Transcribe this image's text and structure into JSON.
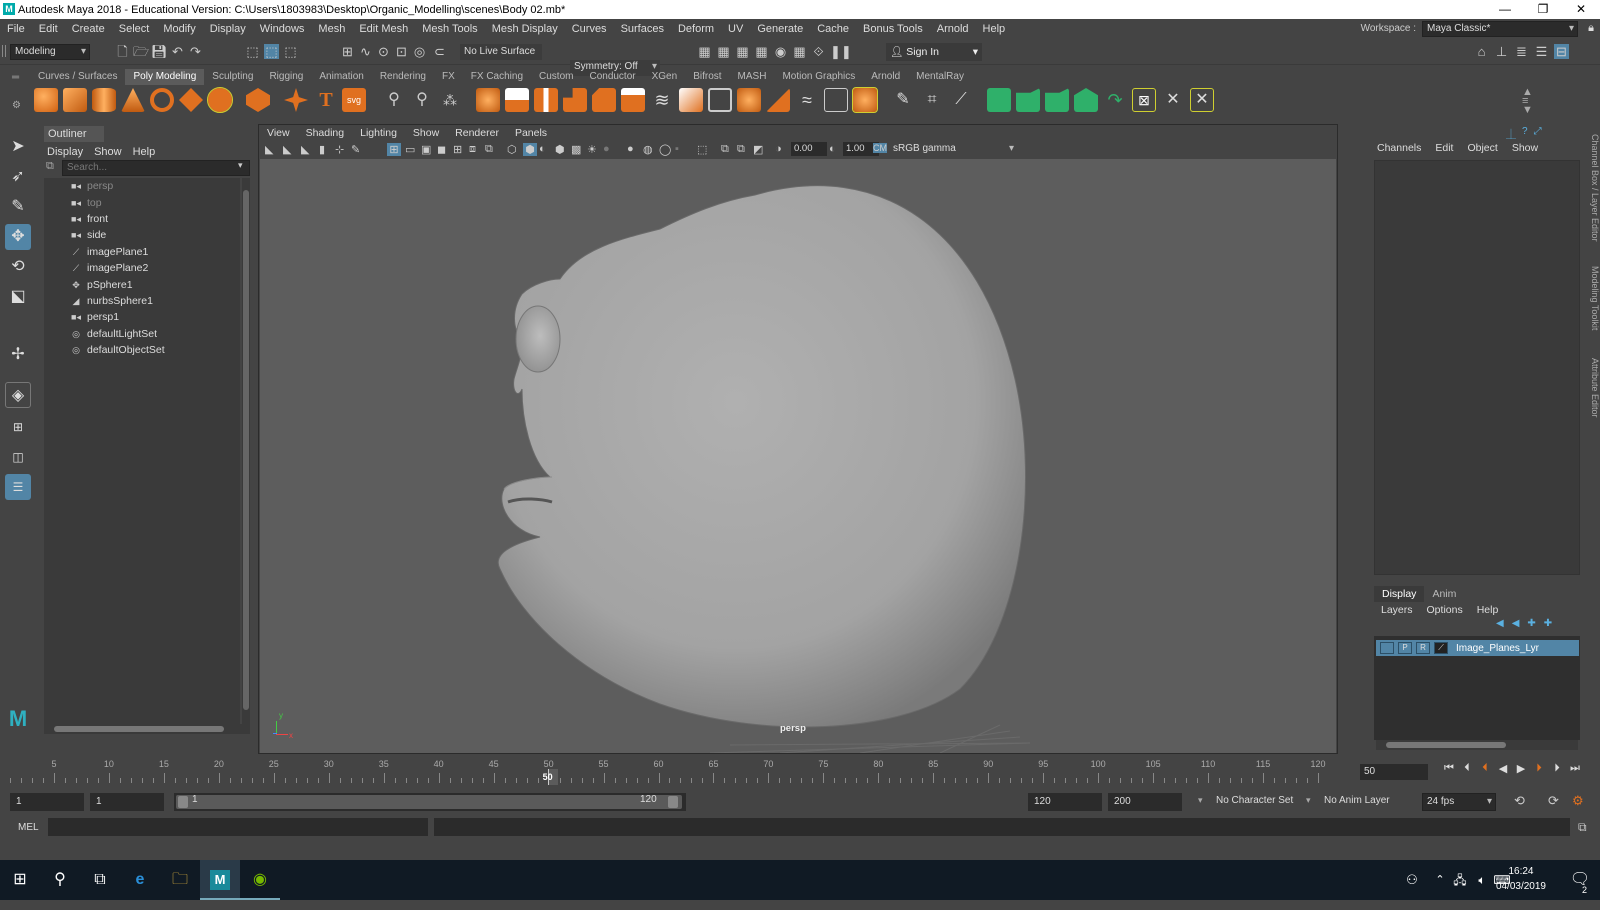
{
  "titlebar": {
    "title": "Autodesk Maya 2018 - Educational Version: C:\\Users\\1803983\\Desktop\\Organic_Modelling\\scenes\\Body 02.mb*",
    "minimize": "—",
    "restore": "❐",
    "close": "✕"
  },
  "menubar": [
    "File",
    "Edit",
    "Create",
    "Select",
    "Modify",
    "Display",
    "Windows",
    "Mesh",
    "Edit Mesh",
    "Mesh Tools",
    "Mesh Display",
    "Curves",
    "Surfaces",
    "Deform",
    "UV",
    "Generate",
    "Cache",
    "Bonus Tools",
    "Arnold",
    "Help"
  ],
  "workspace": {
    "label": "Workspace :",
    "value": "Maya Classic*"
  },
  "statusline": {
    "menuset": "Modeling",
    "live_surface": "No Live Surface",
    "symmetry": "Symmetry: Off",
    "sign_in": "Sign In"
  },
  "shelf_tabs": [
    "Curves / Surfaces",
    "Poly Modeling",
    "Sculpting",
    "Rigging",
    "Animation",
    "Rendering",
    "FX",
    "FX Caching",
    "Custom",
    "Conductor",
    "XGen",
    "Bifrost",
    "MASH",
    "Motion Graphics",
    "Arnold",
    "MentalRay"
  ],
  "shelf_active": "Poly Modeling",
  "shelf_text_icons": {
    "text_tool": "T",
    "svg_tool": "svg"
  },
  "outliner": {
    "title": "Outliner",
    "menu": [
      "Display",
      "Show",
      "Help"
    ],
    "search_placeholder": "Search...",
    "items": [
      {
        "label": "persp",
        "icon": "camera-icon",
        "dim": true
      },
      {
        "label": "top",
        "icon": "camera-icon",
        "dim": true
      },
      {
        "label": "front",
        "icon": "camera-icon",
        "dim": false
      },
      {
        "label": "side",
        "icon": "camera-icon",
        "dim": false
      },
      {
        "label": "imagePlane1",
        "icon": "image-plane-icon",
        "dim": false
      },
      {
        "label": "imagePlane2",
        "icon": "image-plane-icon",
        "dim": false
      },
      {
        "label": "pSphere1",
        "icon": "transform-icon",
        "dim": false
      },
      {
        "label": "nurbsSphere1",
        "icon": "nurbs-icon",
        "dim": false
      },
      {
        "label": "persp1",
        "icon": "camera-icon",
        "dim": false
      },
      {
        "label": "defaultLightSet",
        "icon": "set-icon",
        "dim": false
      },
      {
        "label": "defaultObjectSet",
        "icon": "set-icon",
        "dim": false
      }
    ]
  },
  "viewport": {
    "menu": [
      "View",
      "Shading",
      "Lighting",
      "Show",
      "Renderer",
      "Panels"
    ],
    "exposure": "0.00",
    "gamma": "1.00",
    "color_space": "sRGB gamma",
    "camera_label": "persp",
    "axis_y": "y",
    "axis_x": "x",
    "background_color": "#5d5d5d",
    "model_color": "#a9a9a9"
  },
  "channelbox": {
    "menu": [
      "Channels",
      "Edit",
      "Object",
      "Show"
    ]
  },
  "layer_editor": {
    "tabs": [
      "Display",
      "Anim"
    ],
    "active_tab": "Display",
    "menu": [
      "Layers",
      "Options",
      "Help"
    ],
    "layer": {
      "v": "",
      "p": "P",
      "r": "R",
      "name": "Image_Planes_Lyr"
    }
  },
  "side_tabs": [
    "Channel Box / Layer Editor",
    "Modeling Toolkit",
    "Attribute Editor"
  ],
  "timeline": {
    "ticks": [
      5,
      10,
      15,
      20,
      25,
      30,
      35,
      40,
      45,
      50,
      55,
      60,
      65,
      70,
      75,
      80,
      85,
      90,
      95,
      100,
      105,
      110,
      115,
      120
    ],
    "current_frame": "50",
    "current_frame_field": "50"
  },
  "range": {
    "start_field": "1",
    "playback_start": "1",
    "slider_start": "1",
    "slider_end": "120",
    "playback_end": "120",
    "end_field": "200",
    "character_set": "No Character Set",
    "anim_layer": "No Anim Layer",
    "fps": "24 fps"
  },
  "cmdline": {
    "label": "MEL"
  },
  "taskbar": {
    "time": "16:24",
    "date": "04/03/2019",
    "start_glyph": "⊞",
    "maya_glyph": "M",
    "notification_count": "2"
  }
}
